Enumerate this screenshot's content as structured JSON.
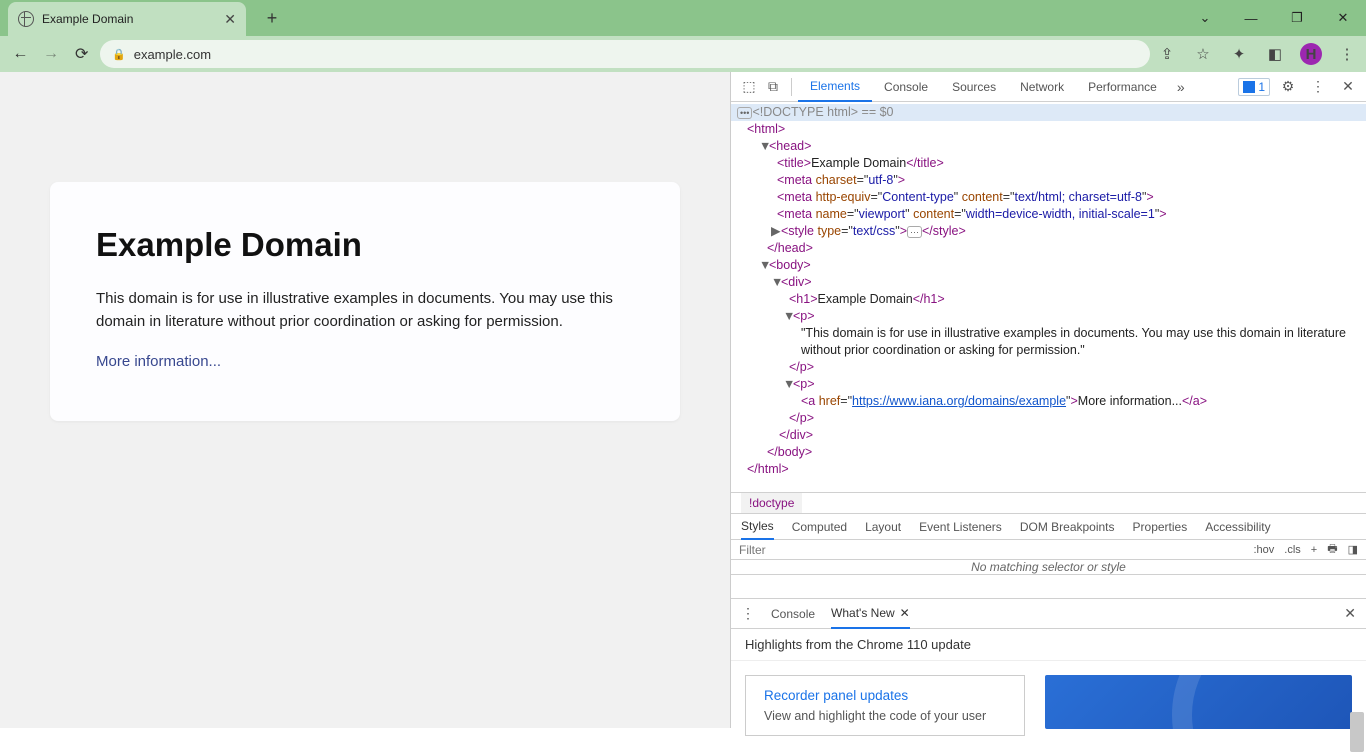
{
  "browser": {
    "tab_title": "Example Domain",
    "url": "example.com",
    "avatar_letter": "H"
  },
  "page": {
    "heading": "Example Domain",
    "paragraph": "This domain is for use in illustrative examples in documents. You may use this domain in literature without prior coordination or asking for permission.",
    "link_text": "More information..."
  },
  "devtools": {
    "tabs": [
      "Elements",
      "Console",
      "Sources",
      "Network",
      "Performance"
    ],
    "issues_count": "1",
    "dom": {
      "doctype": "<!DOCTYPE html>",
      "selected_suffix": " == $0",
      "title_text": "Example Domain",
      "meta_charset": "utf-8",
      "meta_http_equiv": "Content-type",
      "meta_content_type": "text/html; charset=utf-8",
      "meta_viewport_name": "viewport",
      "meta_viewport_content": "width=device-width, initial-scale=1",
      "style_type": "text/css",
      "h1_text": "Example Domain",
      "p_text": "\"This domain is for use in illustrative examples in documents. You may use this domain in literature without prior coordination or asking for permission.\"",
      "a_href": "https://www.iana.org/domains/example",
      "a_text": "More information..."
    },
    "breadcrumb": "!doctype",
    "styles_tabs": [
      "Styles",
      "Computed",
      "Layout",
      "Event Listeners",
      "DOM Breakpoints",
      "Properties",
      "Accessibility"
    ],
    "filter_placeholder": "Filter",
    "hov": ":hov",
    "cls": ".cls",
    "no_match": "No matching selector or style",
    "drawer_tabs": {
      "console": "Console",
      "whatsnew": "What's New"
    },
    "highlights": "Highlights from the Chrome 110 update",
    "wn_card_title": "Recorder panel updates",
    "wn_card_sub": "View and highlight the code of your user"
  }
}
